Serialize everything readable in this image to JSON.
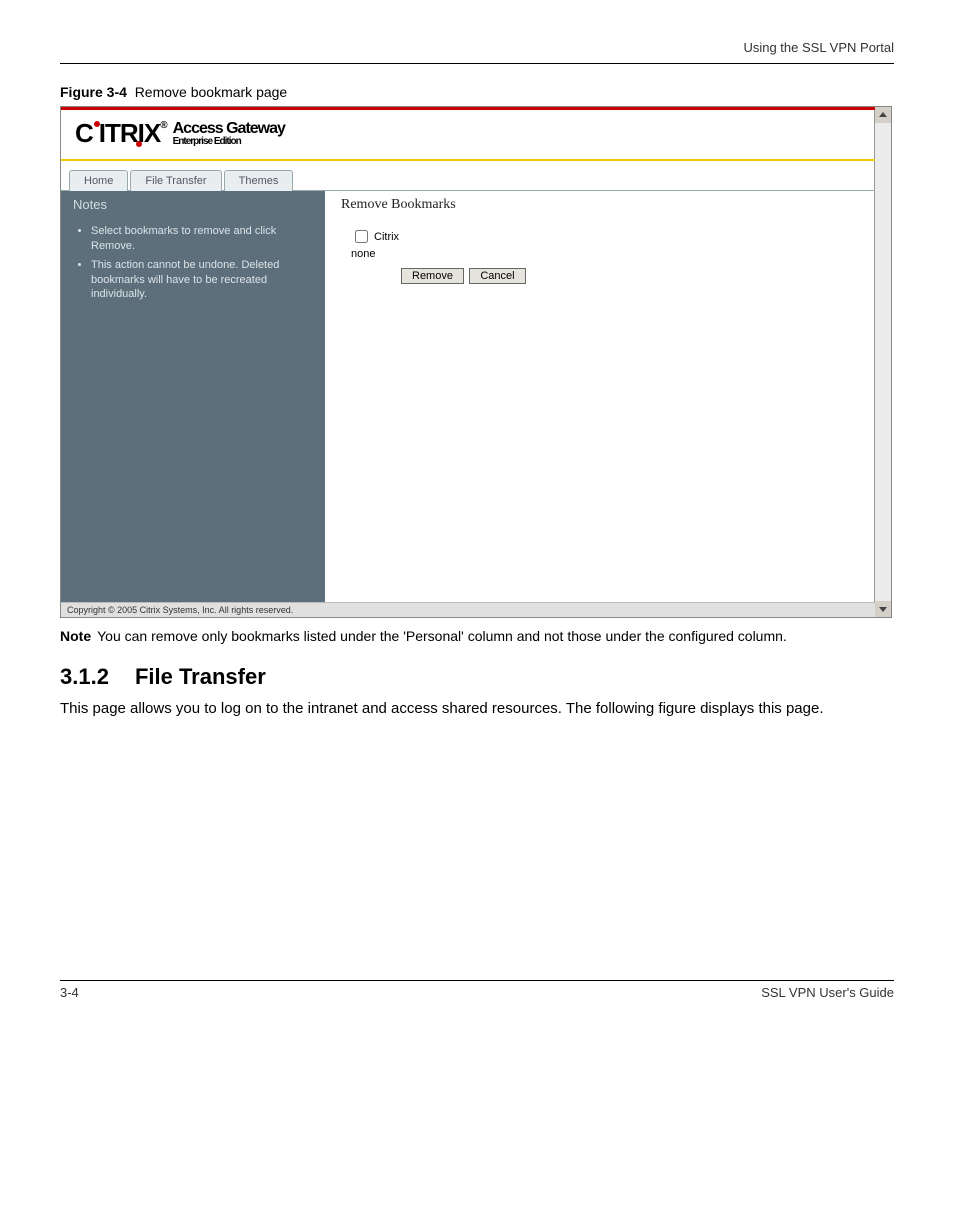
{
  "header": {
    "context": "Using the SSL VPN Portal"
  },
  "figure": {
    "label": "Figure 3-4",
    "title": "Remove bookmark page"
  },
  "screenshot": {
    "brand": {
      "name": "CITRIX",
      "product": "Access Gateway",
      "edition": "Enterprise Edition",
      "reg": "®"
    },
    "tabs": {
      "home": "Home",
      "file_transfer": "File Transfer",
      "themes": "Themes"
    },
    "sidebar": {
      "title": "Notes",
      "bullets": [
        "Select bookmarks to remove and click Remove.",
        "This action cannot be undone. Deleted bookmarks will have to be recreated individually."
      ]
    },
    "content": {
      "heading": "Remove Bookmarks",
      "checkbox_label": "Citrix",
      "none_label": "none",
      "remove_btn": "Remove",
      "cancel_btn": "Cancel"
    },
    "copyright": "Copyright © 2005 Citrix Systems, Inc. All rights reserved."
  },
  "note": {
    "label": "Note",
    "text": "You can remove only bookmarks listed under the 'Personal' column and not those under the configured column."
  },
  "section": {
    "number": "3.1.2",
    "title": "File Transfer",
    "para": "This page allows you to log on to the intranet and access shared resources. The following figure displays this page."
  },
  "footer": {
    "page": "3-4",
    "doc_title": "SSL VPN User's Guide"
  }
}
